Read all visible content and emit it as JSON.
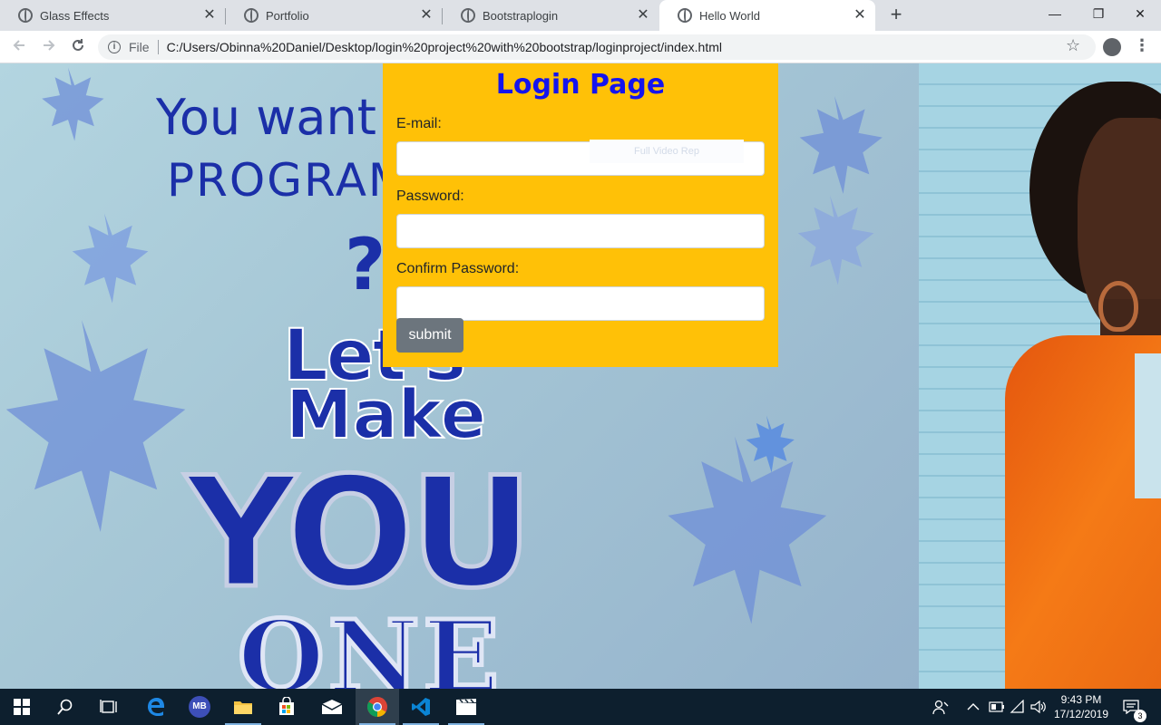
{
  "browser": {
    "tabs": [
      {
        "title": "Glass Effects",
        "active": false
      },
      {
        "title": "Portfolio",
        "active": false
      },
      {
        "title": "Bootstraplogin",
        "active": false
      },
      {
        "title": "Hello World",
        "active": true
      }
    ],
    "close_glyph": "✕",
    "new_tab_glyph": "+",
    "window_controls": {
      "minimize": "—",
      "restore": "❐",
      "close": "✕"
    },
    "address": {
      "scheme_label": "File",
      "url": "C:/Users/Obinna%20Daniel/Desktop/login%20project%20with%20bootstrap/loginproject/index.html"
    },
    "icons": {
      "back": "arrow-left-icon",
      "forward": "arrow-right-icon",
      "reload": "reload-icon",
      "info": "info-icon",
      "bookmark": "star-icon",
      "profile": "account-icon",
      "menu": "kebab-menu-icon"
    }
  },
  "poster": {
    "line1": "You want",
    "line2": "PROGRAM",
    "line3": "?",
    "line4": "Let's",
    "line5": "Make",
    "line6": "YOU",
    "line7": "ONE"
  },
  "login": {
    "title": "Login Page",
    "email_label": "E-mail:",
    "email_value": "",
    "ghost_text": "Full Video Rep",
    "password_label": "Password:",
    "password_value": "",
    "confirm_label": "Confirm Password:",
    "confirm_value": "",
    "submit_label": "submit",
    "colors": {
      "card": "#ffc107",
      "title": "#1414ee",
      "button": "#6c757d"
    }
  },
  "taskbar": {
    "apps": [
      "start-icon",
      "search-icon",
      "task-view-icon",
      "edge-icon",
      "malwarebytes-icon",
      "file-explorer-icon",
      "store-icon",
      "mail-icon",
      "chrome-icon",
      "vscode-icon",
      "media-icon"
    ],
    "mb_label": "MB",
    "time": "9:43 PM",
    "date": "17/12/2019",
    "notification_count": "3"
  }
}
